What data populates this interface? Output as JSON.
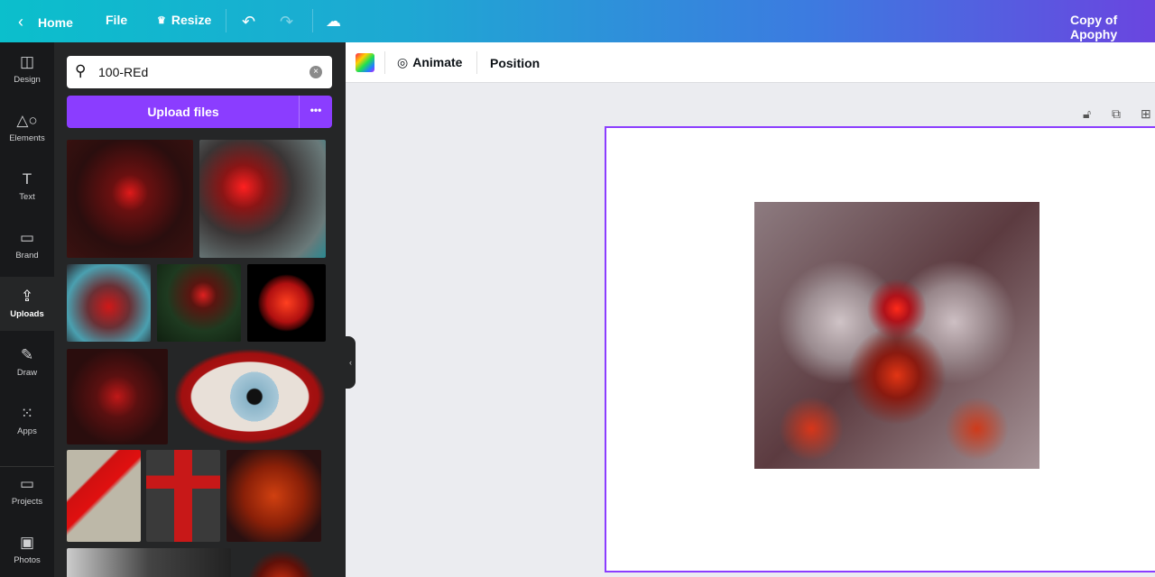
{
  "topbar": {
    "home": "Home",
    "file": "File",
    "resize": "Resize",
    "title": "Copy of Apophy"
  },
  "rail": [
    {
      "label": "Design",
      "icon": "layout-icon"
    },
    {
      "label": "Elements",
      "icon": "shapes-icon"
    },
    {
      "label": "Text",
      "icon": "text-icon"
    },
    {
      "label": "Brand",
      "icon": "brand-icon"
    },
    {
      "label": "Uploads",
      "icon": "cloud-upload-icon"
    },
    {
      "label": "Draw",
      "icon": "pen-icon"
    },
    {
      "label": "Apps",
      "icon": "grid-icon"
    },
    {
      "label": "Projects",
      "icon": "folder-icon"
    },
    {
      "label": "Photos",
      "icon": "image-icon"
    }
  ],
  "panel": {
    "search_value": "100-REd",
    "upload_label": "Upload files",
    "more": "•••"
  },
  "toolbar": {
    "animate": "Animate",
    "position": "Position"
  },
  "colors": {
    "accent": "#8b3dff"
  }
}
